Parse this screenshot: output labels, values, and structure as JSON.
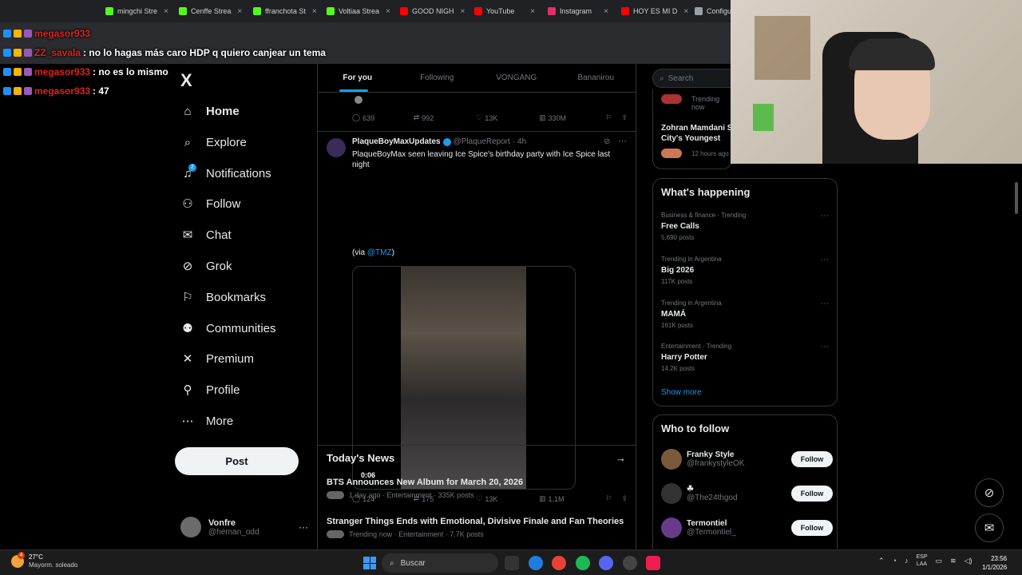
{
  "browser": {
    "tabs": [
      {
        "label": "mingchi Stre",
        "color": "#53fc18"
      },
      {
        "label": "Cenffe Strea",
        "color": "#53fc18"
      },
      {
        "label": "ffranchota St",
        "color": "#53fc18"
      },
      {
        "label": "Voltiaa Strea",
        "color": "#53fc18"
      },
      {
        "label": "GOOD NIGH",
        "color": "#ff0000"
      },
      {
        "label": "YouTube",
        "color": "#ff0000"
      },
      {
        "label": "Instagram",
        "color": "#e1306c"
      },
      {
        "label": "HOY ES MI D",
        "color": "#ff0000"
      },
      {
        "label": "Configura",
        "color": "#9aa0a6"
      }
    ],
    "close_glyph": "×"
  },
  "chat": [
    {
      "user": "megasor933",
      "message": ""
    },
    {
      "user": "ZZ_savala",
      "message": ": no lo hagas más caro HDP q quiero canjear un tema"
    },
    {
      "user": "megasor933",
      "message": ": no es lo mismo"
    },
    {
      "user": "megasor933",
      "message": ": 47"
    }
  ],
  "sidebar": {
    "logo": "X",
    "notif_count": "2",
    "items": [
      {
        "label": "Home",
        "icon": "home-icon",
        "glyph": "⌂"
      },
      {
        "label": "Explore",
        "icon": "search-icon",
        "glyph": "⌕"
      },
      {
        "label": "Notifications",
        "icon": "bell-icon",
        "glyph": "♫"
      },
      {
        "label": "Follow",
        "icon": "person-add-icon",
        "glyph": "⚇"
      },
      {
        "label": "Chat",
        "icon": "mail-icon",
        "glyph": "✉"
      },
      {
        "label": "Grok",
        "icon": "grok-icon",
        "glyph": "⊘"
      },
      {
        "label": "Bookmarks",
        "icon": "bookmark-icon",
        "glyph": "⚐"
      },
      {
        "label": "Communities",
        "icon": "communities-icon",
        "glyph": "⚉"
      },
      {
        "label": "Premium",
        "icon": "x-icon",
        "glyph": "✕"
      },
      {
        "label": "Profile",
        "icon": "person-icon",
        "glyph": "⚲"
      },
      {
        "label": "More",
        "icon": "more-icon",
        "glyph": "⋯"
      }
    ],
    "post_label": "Post",
    "profile": {
      "name": "Vonfre",
      "handle": "@hernan_odd",
      "more": "···"
    }
  },
  "feed": {
    "tabs": [
      "For you",
      "Following",
      "VONGANG",
      "Bananirou"
    ],
    "prev_stats": {
      "replies": "639",
      "reposts": "992",
      "likes": "13K",
      "views": "330M"
    },
    "tweet": {
      "name": "PlaqueBoyMaxUpdates",
      "handle": "@PlaqueReport",
      "time": "· 4h",
      "text": "PlaqueBoyMax seen leaving Ice Spice's birthday party with Ice Spice last night",
      "via_prefix": "(via ",
      "via_link": "@TMZ",
      "via_suffix": ")",
      "duration": "0:06",
      "stats": {
        "replies": "124",
        "reposts": "175",
        "likes": "13K",
        "views": "1.1M"
      }
    },
    "news": {
      "header": "Today's News",
      "items": [
        {
          "title": "BTS Announces New Album for March 20, 2026",
          "meta": "1 day ago · Entertainment · 335K posts"
        },
        {
          "title": "Stranger Things Ends with Emotional, Divisive Finale and Fan Theories",
          "meta": "Trending now · Entertainment · 7.7K posts"
        }
      ]
    }
  },
  "right": {
    "search_placeholder": "Search",
    "top_trend": {
      "ctx": "Trending now",
      "title": "Zohran Mamdani S City's Youngest Ma",
      "time": "12 hours ago"
    },
    "happening": {
      "title": "What's happening",
      "trends": [
        {
          "ctx": "Business & finance · Trending",
          "name": "Free Calls",
          "count": "5,690 posts"
        },
        {
          "ctx": "Trending in Argentina",
          "name": "Big 2026",
          "count": "117K posts"
        },
        {
          "ctx": "Trending in Argentina",
          "name": "MAMÁ",
          "count": "161K posts"
        },
        {
          "ctx": "Entertainment · Trending",
          "name": "Harry Potter",
          "count": "14.2K posts"
        }
      ],
      "show_more": "Show more"
    },
    "who_to_follow": {
      "title": "Who to follow",
      "accounts": [
        {
          "name": "Franky Style",
          "handle": "@frankystyleOK",
          "color": "#7a5a3a"
        },
        {
          "name": "☘",
          "handle": "@The24thgod",
          "color": "#333333"
        },
        {
          "name": "Termontiel",
          "handle": "@Termontiel_",
          "color": "#6a3a8a"
        }
      ],
      "follow_label": "Follow"
    }
  },
  "taskbar": {
    "temp": "27°C",
    "weather": "Mayorm. soleado",
    "weather_badge": "4",
    "search_placeholder": "Buscar",
    "lang_top": "ESP",
    "lang_bottom": "LAA",
    "time": "23:56",
    "date": "1/1/2026"
  }
}
